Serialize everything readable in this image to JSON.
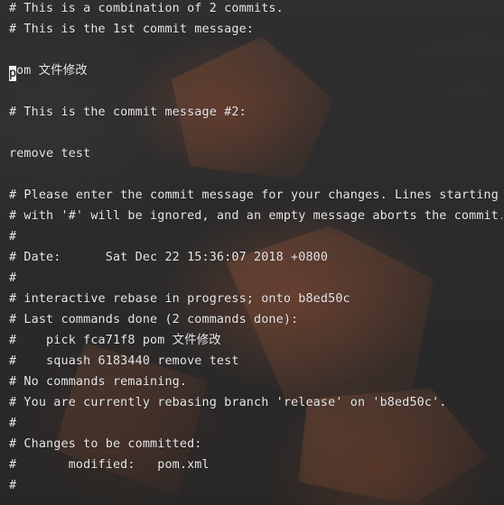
{
  "editor": {
    "cursor_char": "p",
    "lines": [
      "# This is a combination of 2 commits.",
      "# This is the 1st commit message:",
      "",
      "om 文件修改",
      "",
      "# This is the commit message #2:",
      "",
      "remove test",
      "",
      "# Please enter the commit message for your changes. Lines starting",
      "# with '#' will be ignored, and an empty message aborts the commit.",
      "#",
      "# Date:      Sat Dec 22 15:36:07 2018 +0800",
      "#",
      "# interactive rebase in progress; onto b8ed50c",
      "# Last commands done (2 commands done):",
      "#    pick fca71f8 pom 文件修改",
      "#    squash 6183440 remove test",
      "# No commands remaining.",
      "# You are currently rebasing branch 'release' on 'b8ed50c'.",
      "#",
      "# Changes to be committed:",
      "#       modified:   pom.xml",
      "#"
    ]
  }
}
